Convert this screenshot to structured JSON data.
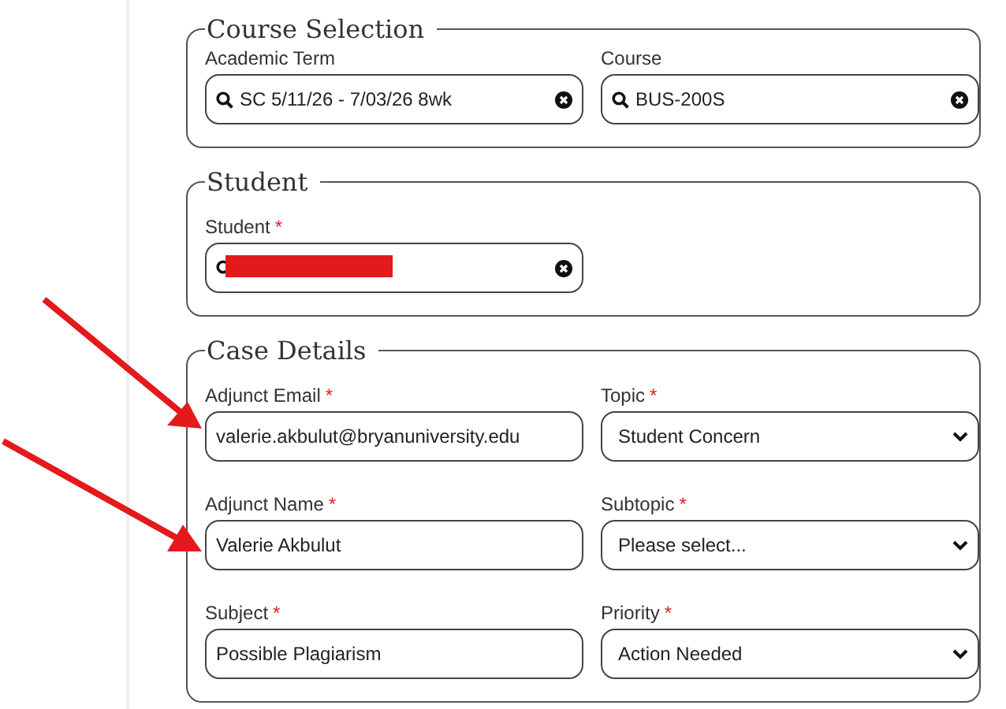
{
  "sections": [
    {
      "title": "Course Selection",
      "fields": [
        {
          "label": "Academic Term",
          "kind": "search",
          "value": "SC 5/11/26 - 7/03/26 8wk"
        },
        {
          "label": "Course",
          "kind": "search",
          "value": "BUS-200S"
        }
      ]
    },
    {
      "title": "Student",
      "fields": [
        {
          "label": "Student",
          "required_mark": "*",
          "kind": "search",
          "redacted": true
        }
      ]
    },
    {
      "title": "Case Details",
      "fields": [
        {
          "label": "Adjunct Email",
          "required_mark": "*",
          "kind": "text",
          "value": "valerie.akbulut@bryanuniversity.edu"
        },
        {
          "label": "Topic",
          "required_mark": "*",
          "kind": "select",
          "value": "Student Concern"
        },
        {
          "label": "Adjunct Name",
          "required_mark": "*",
          "kind": "text",
          "value": "Valerie Akbulut"
        },
        {
          "label": "Subtopic",
          "required_mark": "*",
          "kind": "select",
          "value": "Please select..."
        },
        {
          "label": "Subject",
          "required_mark": "*",
          "kind": "text",
          "value": "Possible Plagiarism"
        },
        {
          "label": "Priority",
          "required_mark": "*",
          "kind": "select",
          "value": "Action Needed"
        }
      ]
    }
  ]
}
